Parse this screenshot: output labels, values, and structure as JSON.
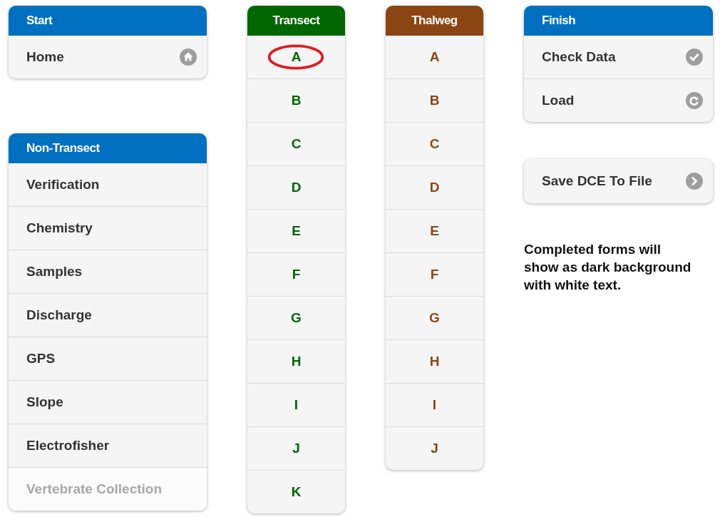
{
  "columns": [
    {
      "blocks": [
        {
          "kind": "list-card",
          "title": "Start",
          "color": "#0070c0",
          "items": [
            {
              "label": "Home",
              "kind": "home",
              "disabled": false
            }
          ]
        },
        {
          "kind": "list-card",
          "title": "Non-Transect",
          "color": "#0070c0",
          "items": [
            {
              "label": "Verification",
              "disabled": false
            },
            {
              "label": "Chemistry",
              "disabled": false
            },
            {
              "label": "Samples",
              "disabled": false
            },
            {
              "label": "Discharge",
              "disabled": false
            },
            {
              "label": "GPS",
              "disabled": false
            },
            {
              "label": "Slope",
              "disabled": false
            },
            {
              "label": "Electrofisher",
              "disabled": false
            },
            {
              "label": "Vertebrate Collection",
              "disabled": true
            }
          ]
        }
      ]
    },
    {
      "blocks": [
        {
          "kind": "letter-card",
          "title": "Transect",
          "color": "#006600",
          "items": [
            {
              "label": "A",
              "circled": true
            },
            {
              "label": "B",
              "circled": false
            },
            {
              "label": "C",
              "circled": false
            },
            {
              "label": "D",
              "circled": false
            },
            {
              "label": "E",
              "circled": false
            },
            {
              "label": "F",
              "circled": false
            },
            {
              "label": "G",
              "circled": false
            },
            {
              "label": "H",
              "circled": false
            },
            {
              "label": "I",
              "circled": false
            },
            {
              "label": "J",
              "circled": false
            },
            {
              "label": "K",
              "circled": false
            }
          ]
        }
      ]
    },
    {
      "blocks": [
        {
          "kind": "letter-card",
          "title": "Thalweg",
          "color": "#8b4513",
          "items": [
            {
              "label": "A",
              "circled": false
            },
            {
              "label": "B",
              "circled": false
            },
            {
              "label": "C",
              "circled": false
            },
            {
              "label": "D",
              "circled": false
            },
            {
              "label": "E",
              "circled": false
            },
            {
              "label": "F",
              "circled": false
            },
            {
              "label": "G",
              "circled": false
            },
            {
              "label": "H",
              "circled": false
            },
            {
              "label": "I",
              "circled": false
            },
            {
              "label": "J",
              "circled": false
            }
          ]
        }
      ]
    },
    {
      "blocks": [
        {
          "kind": "list-card",
          "title": "Finish",
          "color": "#0070c0",
          "items": [
            {
              "label": "Check Data",
              "kind": "check",
              "disabled": false
            },
            {
              "label": "Load",
              "kind": "redo",
              "disabled": false
            }
          ]
        },
        {
          "kind": "button",
          "label": "Save DCE To File"
        },
        {
          "kind": "note",
          "text": "Completed forms will show as dark background with white text."
        }
      ]
    }
  ]
}
